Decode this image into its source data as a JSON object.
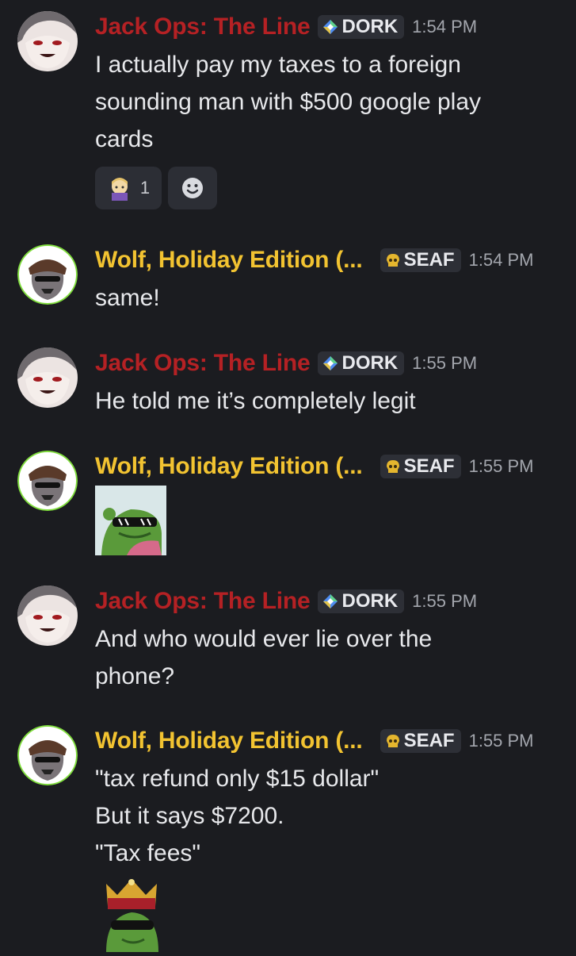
{
  "colors": {
    "background": "#1b1c20",
    "jack_name": "#b52124",
    "wolf_name": "#f2c331",
    "tag_bg": "#2d2f36",
    "timestamp": "#a3a6ad"
  },
  "messages": [
    {
      "author": "Jack Ops: The Line",
      "tag": "DORK",
      "tag_icon": "diamond-icon",
      "time": "1:54 PM",
      "lines": [
        "I actually pay my taxes to a foreign",
        "sounding man with $500 google play",
        "cards"
      ],
      "reactions": [
        {
          "emoji": "anime-girl-emoji",
          "count": "1"
        },
        {
          "emoji": "add-reaction-icon",
          "count": ""
        }
      ]
    },
    {
      "author": "Wolf, Holiday Edition (...",
      "tag": "SEAF",
      "tag_icon": "skull-icon",
      "time": "1:54 PM",
      "lines": [
        "same!"
      ]
    },
    {
      "author": "Jack Ops: The Line",
      "tag": "DORK",
      "tag_icon": "diamond-icon",
      "time": "1:55 PM",
      "lines": [
        "He told me it’s completely legit"
      ]
    },
    {
      "author": "Wolf, Holiday Edition (...",
      "tag": "SEAF",
      "tag_icon": "skull-icon",
      "time": "1:55 PM",
      "lines": [],
      "image": "pepe-sunglasses-emoji"
    },
    {
      "author": "Jack Ops: The Line",
      "tag": "DORK",
      "tag_icon": "diamond-icon",
      "time": "1:55 PM",
      "lines": [
        "And who would ever lie over the",
        "phone?"
      ]
    },
    {
      "author": "Wolf, Holiday Edition (...",
      "tag": "SEAF",
      "tag_icon": "skull-icon",
      "time": "1:55 PM",
      "lines": [
        "\"tax refund only $15 dollar\"",
        "But it says $7200.",
        "\"Tax fees\""
      ],
      "image": "pepe-king-crown-emoji"
    }
  ]
}
